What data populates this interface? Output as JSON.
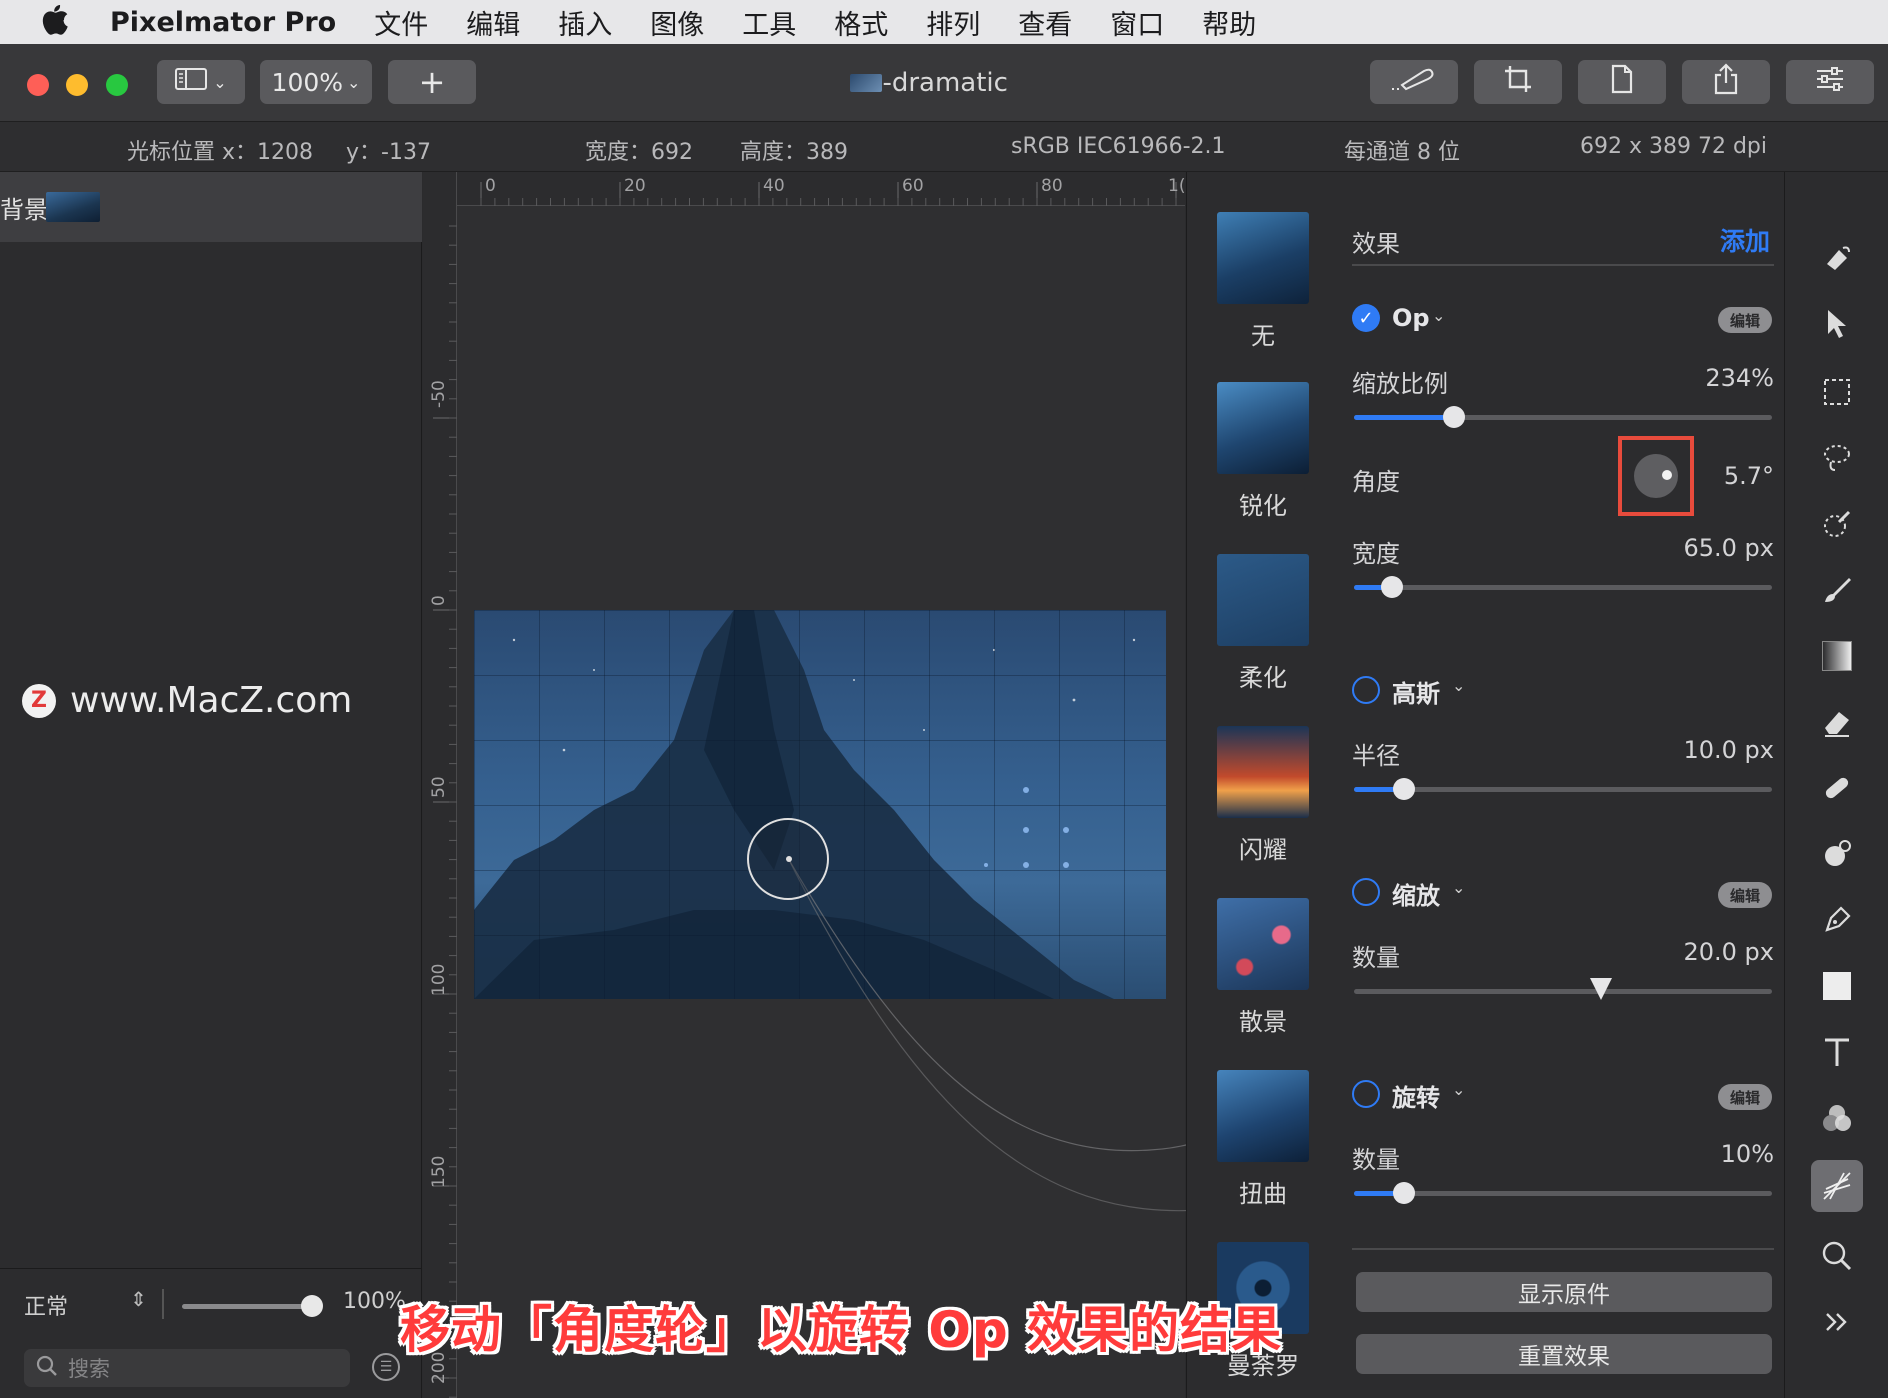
{
  "menubar": {
    "app_name": "Pixelmator Pro",
    "items": [
      "文件",
      "编辑",
      "插入",
      "图像",
      "工具",
      "格式",
      "排列",
      "查看",
      "窗口",
      "帮助"
    ]
  },
  "toolbar": {
    "zoom": "100%",
    "add_label": "+",
    "doc_title": "en-dramatic"
  },
  "infobar": {
    "cursor_x": "光标位置 x：1208",
    "cursor_y": "y：-137",
    "width": "宽度：692",
    "height": "高度：389",
    "color_profile": "sRGB IEC61966-2.1",
    "bit_depth": "每通道 8 位",
    "size_dpi": "692 x 389 72 dpi"
  },
  "layers": {
    "layer_name": "背景图层",
    "blend_mode": "正常",
    "opacity": "100%",
    "opacity_fraction": 1.0,
    "search_placeholder": "搜索"
  },
  "watermark": {
    "logo_letter": "Z",
    "text": "www.MacZ.com"
  },
  "rulers": {
    "top": [
      "0",
      "20",
      "40",
      "60",
      "80",
      "1("
    ],
    "left": [
      "-50",
      "0",
      "50",
      "100",
      "150",
      "200"
    ]
  },
  "presets": [
    "无",
    "锐化",
    "柔化",
    "闪耀",
    "散景",
    "扭曲",
    "曼荼罗"
  ],
  "effects": {
    "header": "效果",
    "add": "添加",
    "edit_badge": "编辑",
    "op": {
      "name": "Op",
      "scale_label": "缩放比例",
      "scale_value": "234%",
      "scale_fraction": 0.24,
      "angle_label": "角度",
      "angle_value": "5.7°",
      "width_label": "宽度",
      "width_value": "65.0 px",
      "width_fraction": 0.09
    },
    "gauss": {
      "name": "高斯",
      "radius_label": "半径",
      "radius_value": "10.0 px",
      "radius_fraction": 0.12
    },
    "zoom": {
      "name": "缩放",
      "amount_label": "数量",
      "amount_value": "20.0 px",
      "amount_fraction": 0.59
    },
    "rotate": {
      "name": "旋转",
      "amount_label": "数量",
      "amount_value": "10%",
      "amount_fraction": 0.12
    },
    "show_original": "显示原件",
    "reset_effects": "重置效果"
  },
  "tools": [
    "paint-bucket-icon",
    "arrow-icon",
    "marquee-icon",
    "lasso-icon",
    "quick-select-icon",
    "brush-icon",
    "gradient-icon",
    "eraser-icon",
    "bandage-icon",
    "retouch-icon",
    "pen-icon",
    "shape-icon",
    "text-icon",
    "color-adjust-icon",
    "effects-icon",
    "zoom-icon",
    "more-icon"
  ],
  "caption": "移动「角度轮」以旋转 Op 效果的结果",
  "colors": {
    "accent": "#2f7bf5",
    "highlight_box": "#e84b3c",
    "caption": "#ff3b3b"
  }
}
